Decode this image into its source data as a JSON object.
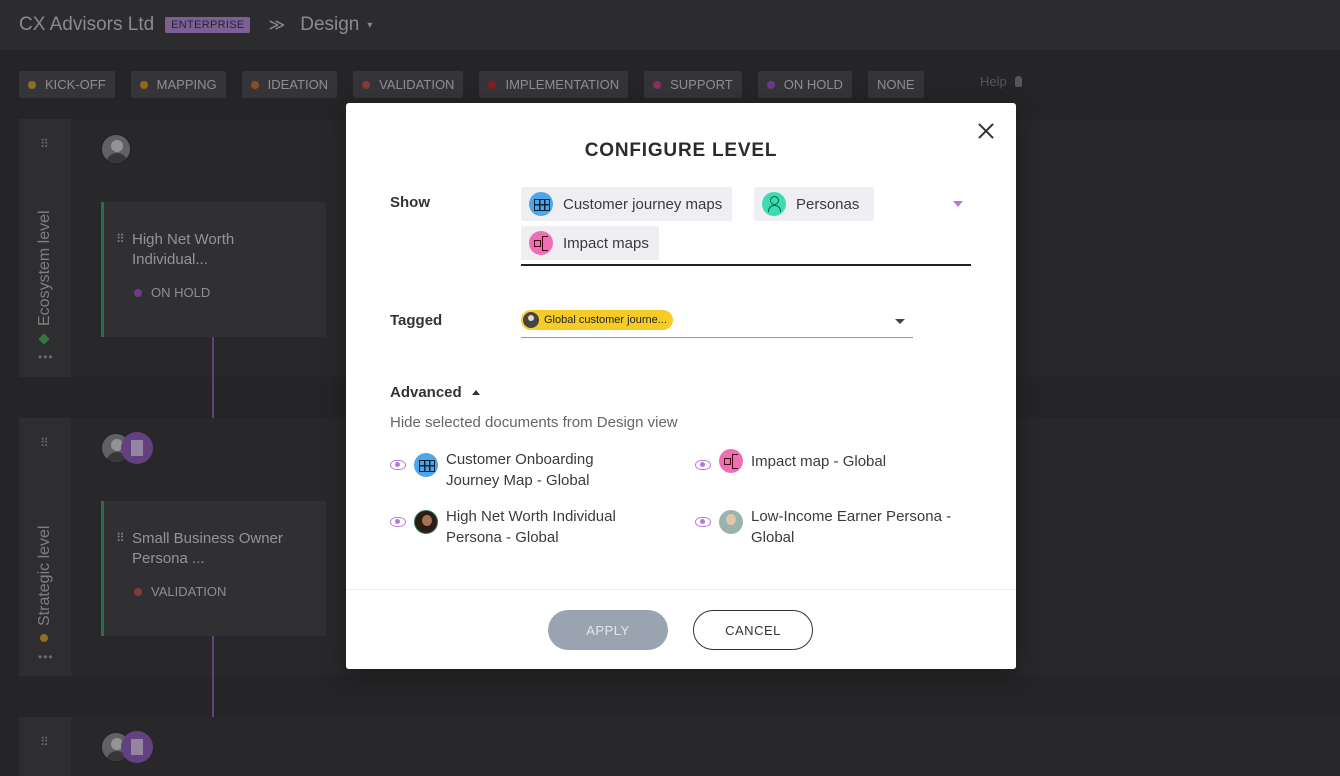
{
  "topbar": {
    "company": "CX Advisors Ltd",
    "badge": "ENTERPRISE",
    "separator": "≫",
    "section": "Design",
    "caret": "▾"
  },
  "phases": [
    {
      "label": "KICK-OFF",
      "color": "#c9a227"
    },
    {
      "label": "MAPPING",
      "color": "#d9961e"
    },
    {
      "label": "IDEATION",
      "color": "#d2691e"
    },
    {
      "label": "VALIDATION",
      "color": "#c0504d"
    },
    {
      "label": "IMPLEMENTATION",
      "color": "#c0262e"
    },
    {
      "label": "SUPPORT",
      "color": "#c0408c"
    },
    {
      "label": "ON HOLD",
      "color": "#a24cc8"
    },
    {
      "label": "NONE",
      "color": ""
    }
  ],
  "help": "Help",
  "lanes": [
    {
      "label": "Ecosystem level",
      "card_title": "High Net Worth Individual...",
      "card_status": "ON HOLD",
      "status_color": "#a24cc8"
    },
    {
      "label": "Strategic level",
      "card_title": "Small Business Owner Persona ...",
      "card_status": "VALIDATION",
      "status_color": "#c0504d"
    }
  ],
  "modal": {
    "title": "CONFIGURE LEVEL",
    "show_label": "Show",
    "show_tags": [
      {
        "label": "Customer journey maps",
        "icon": "grid-icon"
      },
      {
        "label": "Personas",
        "icon": "person-icon"
      },
      {
        "label": "Impact maps",
        "icon": "impact-map-icon"
      }
    ],
    "tagged_label": "Tagged",
    "tagged_value": "Global customer journe...",
    "advanced_label": "Advanced",
    "hint": "Hide selected documents from Design view",
    "documents": [
      {
        "title": "Customer Onboarding Journey Map - Global",
        "line1": "Customer Onboarding",
        "line2": "Journey Map - Global",
        "icon": "grid-icon"
      },
      {
        "title": "Impact map - Global",
        "line1": "Impact map - Global",
        "line2": "",
        "icon": "impact-map-icon"
      },
      {
        "title": "High Net Worth Individual Persona - Global",
        "line1": "High Net Worth Individual",
        "line2": "Persona - Global",
        "icon": "persona-photo"
      },
      {
        "title": "Low-Income Earner Persona - Global",
        "line1": "Low-Income Earner Persona -",
        "line2": "Global",
        "icon": "persona-photo"
      }
    ],
    "apply_label": "APPLY",
    "cancel_label": "CANCEL"
  }
}
